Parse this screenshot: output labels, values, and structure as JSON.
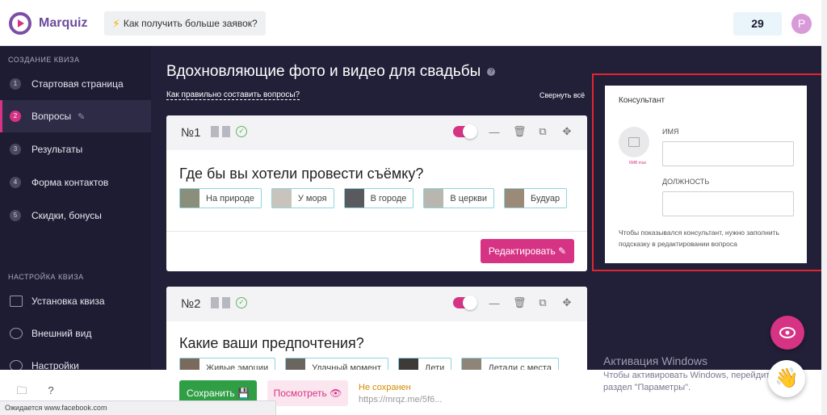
{
  "header": {
    "brand": "Marquiz",
    "tip": "Как получить больше заявок?",
    "counter": "29",
    "avatar_letter": "P"
  },
  "sidebar": {
    "section1": "СОЗДАНИЕ КВИЗА",
    "steps": [
      {
        "num": "1",
        "label": "Стартовая страница"
      },
      {
        "num": "2",
        "label": "Вопросы"
      },
      {
        "num": "3",
        "label": "Результаты"
      },
      {
        "num": "4",
        "label": "Форма контактов"
      },
      {
        "num": "5",
        "label": "Скидки, бонусы"
      }
    ],
    "section2": "НАСТРОЙКА КВИЗА",
    "settings": [
      {
        "label": "Установка квиза"
      },
      {
        "label": "Внешний вид"
      },
      {
        "label": "Настройки"
      }
    ]
  },
  "main": {
    "title": "Вдохновляющие фото и видео для свадьбы",
    "howto": "Как правильно составить вопросы?",
    "collapse_all": "Свернуть всё",
    "edit_label": "Редактировать",
    "questions": [
      {
        "num": "№1",
        "text": "Где бы вы хотели провести съёмку?",
        "answers": [
          "На природе",
          "У моря",
          "В городе",
          "В церкви",
          "Будуар"
        ]
      },
      {
        "num": "№2",
        "text": "Какие ваши предпочтения?",
        "answers": [
          "Живые эмоции",
          "Удачный момент",
          "Дети",
          "Детали с места"
        ]
      }
    ]
  },
  "consultant": {
    "title": "Консультант",
    "photo_size": "6MB max",
    "name_label": "ИМЯ",
    "position_label": "ДОЛЖНОСТЬ",
    "note": "Чтобы показывался консультант, нужно заполнить подсказку в редактировании вопроса"
  },
  "footer": {
    "save_label": "Сохранить",
    "view_label": "Посмотреть",
    "status": "Не сохранен",
    "url": "https://mrqz.me/5f6...",
    "help_icon_label": "?",
    "browser_status": "Ожидается www.facebook.com"
  },
  "windows": {
    "title": "Активация Windows",
    "subtitle": "Чтобы активировать Windows, перейдите в раздел \"Параметры\"."
  },
  "colors": {
    "accent": "#d63384",
    "sidebar_bg": "#1e1c33",
    "main_bg": "#221f38",
    "save_green": "#2f9e44",
    "highlight_red": "#e0262f"
  },
  "icons": [
    "lightning-icon",
    "pencil-icon",
    "check-icon",
    "trash-icon",
    "copy-icon",
    "move-icon",
    "eye-icon",
    "wave-hand-icon",
    "image-placeholder-icon",
    "folder-icon",
    "help-icon"
  ]
}
